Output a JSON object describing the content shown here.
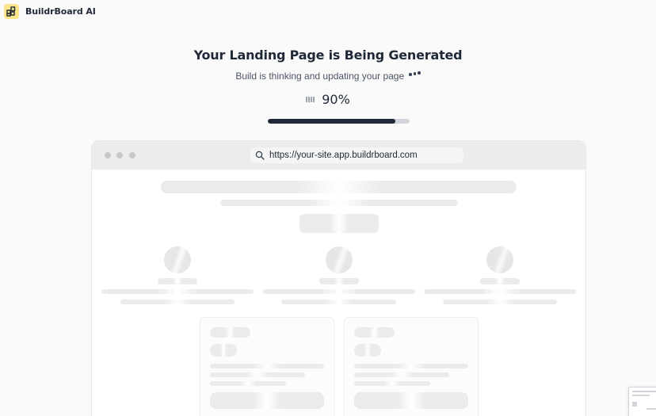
{
  "brand": {
    "name": "BuildrBoard AI",
    "logo_icon": "grid-icon"
  },
  "status": {
    "title": "Your Landing Page is Being Generated",
    "subtitle": "Build is thinking and updating your page",
    "progress_label": "90%",
    "progress": 0.9
  },
  "browser": {
    "url": "https://your-site.app.buildrboard.com"
  },
  "colors": {
    "accent": "#1f2937",
    "logo_bg": "#fde68a",
    "track": "#d1d5db",
    "skeleton": "#ececec"
  }
}
